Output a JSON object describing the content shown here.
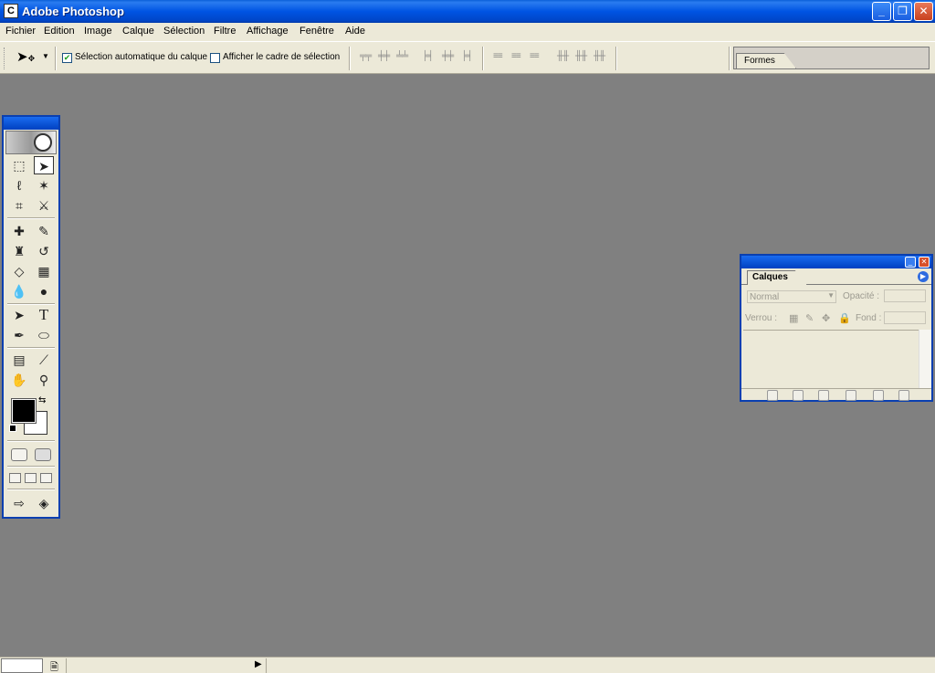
{
  "window": {
    "title": "Adobe Photoshop",
    "app_icon": "photoshop-icon",
    "controls": [
      "minimize",
      "restore",
      "close"
    ]
  },
  "menubar": {
    "items": [
      "Fichier",
      "Edition",
      "Image",
      "Calque",
      "Sélection",
      "Filtre",
      "Affichage",
      "Fenêtre",
      "Aide"
    ]
  },
  "options_bar": {
    "tool_icon": "move-tool-icon",
    "auto_select_label": "Sélection automatique du calque",
    "auto_select_checked": true,
    "show_bounds_label": "Afficher le cadre de sélection",
    "show_bounds_checked": false,
    "palette_well_tab": "Formes"
  },
  "toolbox": {
    "tools": [
      "rectangular-marquee",
      "move",
      "lasso",
      "magic-wand",
      "crop",
      "slice",
      "healing-brush",
      "brush",
      "clone-stamp",
      "history-brush",
      "eraser",
      "gradient",
      "blur",
      "dodge",
      "path-selection",
      "type",
      "pen",
      "ellipse-shape",
      "notes",
      "eyedropper",
      "hand",
      "zoom"
    ],
    "active_tool": "move",
    "type_tool_glyph": "T",
    "foreground_color": "#000000",
    "background_color": "#ffffff"
  },
  "layers_panel": {
    "tab": "Calques",
    "blend_mode": "Normal",
    "opacity_label": "Opacité :",
    "lock_label": "Verrou :",
    "fill_label": "Fond :"
  },
  "colors": {
    "workspace": "#808080",
    "chrome": "#ece9d8",
    "titlebar": "#0054e3"
  }
}
